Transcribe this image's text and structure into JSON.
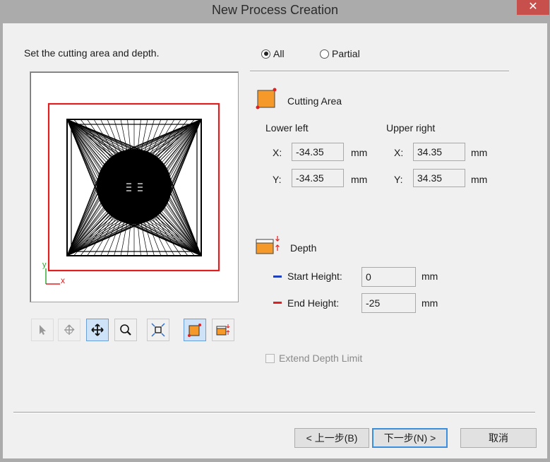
{
  "window": {
    "title": "New Process Creation",
    "close_glyph": "✕"
  },
  "instruction": "Set the cutting area and depth.",
  "mode": {
    "all_label": "All",
    "partial_label": "Partial",
    "selected": "All"
  },
  "cutting_area": {
    "heading": "Cutting Area",
    "lower_left": {
      "label": "Lower left",
      "x_label": "X:",
      "y_label": "Y:",
      "x": "-34.35",
      "y": "-34.35"
    },
    "upper_right": {
      "label": "Upper right",
      "x_label": "X:",
      "y_label": "Y:",
      "x": "34.35",
      "y": "34.35"
    },
    "unit": "mm"
  },
  "depth": {
    "heading": "Depth",
    "start_label": "Start Height:",
    "start_value": "0",
    "end_label": "End Height:",
    "end_value": "-25",
    "unit": "mm",
    "start_color": "#1f3fbf",
    "end_color": "#e02020"
  },
  "extend_depth_label": "Extend Depth Limit",
  "axes": {
    "y": "y",
    "x": "x"
  },
  "toolbar_icons": [
    "select-arrow-icon",
    "pan-rotate-icon",
    "move-icon",
    "zoom-icon",
    "fit-view-icon",
    "cutting-area-icon",
    "depth-icon"
  ],
  "buttons": {
    "back": "< 上一步(B)",
    "next": "下一步(N) >",
    "cancel": "取消"
  },
  "colors": {
    "area_border": "#e02020",
    "area_fill": "#f59a2a",
    "accent": "#3a8edb"
  }
}
